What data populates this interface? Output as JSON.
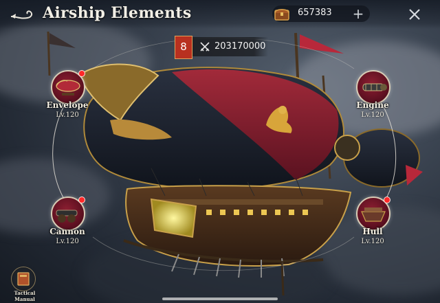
{
  "header": {
    "title": "Airship Elements",
    "back_icon": "curled-arrow-back-icon",
    "close_icon": "close-icon"
  },
  "currency": {
    "icon": "treasure-chest-icon",
    "value": "657383",
    "add_icon": "plus-icon",
    "add_label": "+"
  },
  "power": {
    "level": "8",
    "icon": "crossed-swords-icon",
    "value": "203170000"
  },
  "elements": [
    {
      "name": "Envelope",
      "level": "Lv.120",
      "icon": "balloon-envelope-icon",
      "has_alert": true
    },
    {
      "name": "Engine",
      "level": "Lv.120",
      "icon": "engine-cylinder-icon",
      "has_alert": false
    },
    {
      "name": "Cannon",
      "level": "Lv.120",
      "icon": "cannon-icon",
      "has_alert": true
    },
    {
      "name": "Hull",
      "level": "Lv.120",
      "icon": "hull-icon",
      "has_alert": true
    }
  ],
  "tactical_manual": {
    "label": "Tactical Manual",
    "icon": "book-icon"
  },
  "colors": {
    "alert": "#ff2828",
    "badge": "#b8301f",
    "envelope_red": "#8e1f32",
    "gold": "#c9a14a"
  }
}
